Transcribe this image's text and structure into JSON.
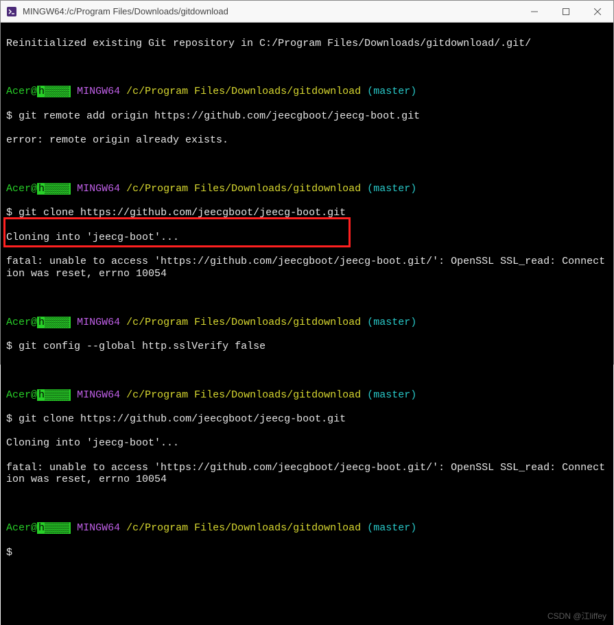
{
  "window": {
    "title": "MINGW64:/c/Program Files/Downloads/gitdownload"
  },
  "prompt": {
    "user": "Acer",
    "at": "@",
    "hostMask": "h▒▒▒▒",
    "shell": "MINGW64",
    "path": "/c/Program Files/Downloads/gitdownload",
    "branchOpen": "(",
    "branch": "master",
    "branchClose": ")",
    "ps1": "$"
  },
  "blocks": {
    "init": {
      "line": "Reinitialized existing Git repository in C:/Program Files/Downloads/gitdownload/.git/"
    },
    "remoteAdd": {
      "cmd": "git remote add origin https://github.com/jeecgboot/jeecg-boot.git",
      "err": "error: remote origin already exists."
    },
    "clone1": {
      "cmd": "git clone https://github.com/jeecgboot/jeecg-boot.git",
      "out1": "Cloning into 'jeecg-boot'...",
      "out2": "fatal: unable to access 'https://github.com/jeecgboot/jeecg-boot.git/': OpenSSL SSL_read: Connection was reset, errno 10054"
    },
    "sslVerify": {
      "cmd": "git config --global http.sslVerify false"
    },
    "clone2": {
      "cmd": "git clone https://github.com/jeecgboot/jeecg-boot.git",
      "out1": "Cloning into 'jeecg-boot'...",
      "out2": "fatal: unable to access 'https://github.com/jeecgboot/jeecg-boot.git/': OpenSSL SSL_read: Connection was reset, errno 10054"
    }
  },
  "watermark": "CSDN @江liffey"
}
